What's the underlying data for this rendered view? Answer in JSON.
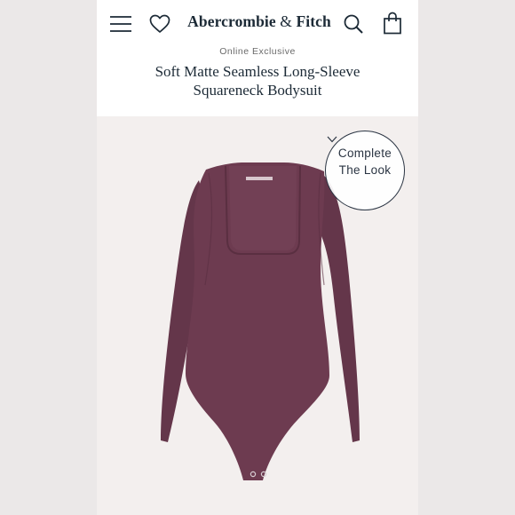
{
  "header": {
    "menu_icon": "hamburger-menu-icon",
    "wishlist_icon": "heart-icon",
    "brand_main": "Abercrombie",
    "brand_amp": " & ",
    "brand_tail": "Fitch",
    "search_icon": "search-icon",
    "bag_icon": "shopping-bag-icon"
  },
  "product": {
    "badge": "Online Exclusive",
    "title_line1": "Soft Matte Seamless Long-Sleeve",
    "title_line2": "Squareneck Bodysuit",
    "color": "#6b3a4e"
  },
  "complete_the_look": {
    "line1": "Complete",
    "line2": "The Look",
    "icon": "chevron-down-icon"
  }
}
